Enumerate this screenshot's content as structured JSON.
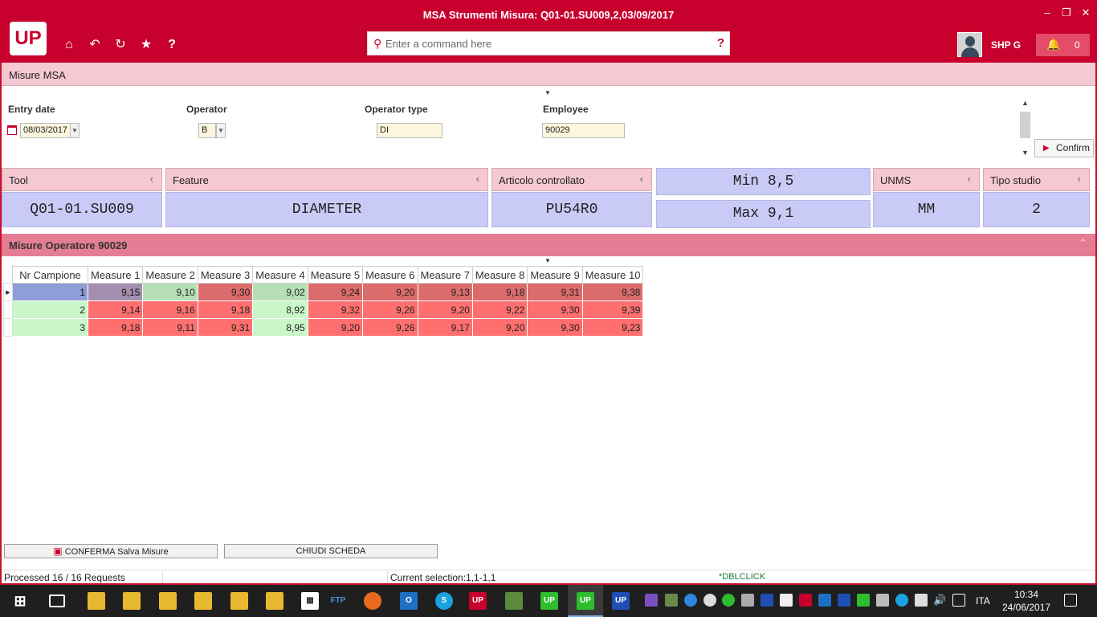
{
  "window": {
    "title": "MSA Strumenti Misura: Q01-01.SU009,2,03/09/2017"
  },
  "toolbar": {
    "logo": "UP",
    "command_placeholder": "Enter a command here",
    "help": "?",
    "user": "SHP G",
    "notifications": "0"
  },
  "header": {
    "title": "Misure MSA"
  },
  "form": {
    "entry_date_label": "Entry date",
    "entry_date": "08/03/2017",
    "operator_label": "Operator",
    "operator": "B",
    "operator_type_label": "Operator type",
    "operator_type": "DI",
    "employee_label": "Employee",
    "employee": "90029",
    "confirm": "Confirm"
  },
  "cards": {
    "tool_label": "Tool",
    "tool": "Q01-01.SU009",
    "feature_label": "Feature",
    "feature": "DIAMETER",
    "articolo_label": "Articolo controllato",
    "articolo": "PU54R0",
    "min": "Min 8,5",
    "max": "Max 9,1",
    "unms_label": "UNMS",
    "unms": "MM",
    "tipo_label": "Tipo studio",
    "tipo": "2"
  },
  "measures": {
    "title": "Misure Operatore 90029",
    "columns": [
      "Nr Campione",
      "Measure 1",
      "Measure 2",
      "Measure 3",
      "Measure 4",
      "Measure 5",
      "Measure 6",
      "Measure 7",
      "Measure 8",
      "Measure 9",
      "Measure 10"
    ],
    "rows": [
      {
        "nr": "1",
        "values": [
          "9,15",
          "9,10",
          "9,30",
          "9,02",
          "9,24",
          "9,20",
          "9,13",
          "9,18",
          "9,31",
          "9,38"
        ]
      },
      {
        "nr": "2",
        "values": [
          "9,14",
          "9,16",
          "9,18",
          "8,92",
          "9,32",
          "9,26",
          "9,20",
          "9,22",
          "9,30",
          "9,39"
        ]
      },
      {
        "nr": "3",
        "values": [
          "9,18",
          "9,11",
          "9,31",
          "8,95",
          "9,20",
          "9,26",
          "9,17",
          "9,20",
          "9,30",
          "9,23"
        ]
      }
    ]
  },
  "buttons": {
    "save": "CONFERMA Salva Misure",
    "close": "CHIUDI SCHEDA"
  },
  "status": {
    "processed": "Processed 16 / 16 Requests",
    "selection": "Current selection:1,1-1,1",
    "dblclick": "*DBLCLICK"
  },
  "taskbar": {
    "lang": "ITA",
    "time": "10:34",
    "date": "24/06/2017"
  },
  "colors": {
    "brand": "#c8002d",
    "in_range": "#c9f7c9",
    "out_of_range": "#ff6f6f",
    "selected": "#8e9ed6"
  }
}
